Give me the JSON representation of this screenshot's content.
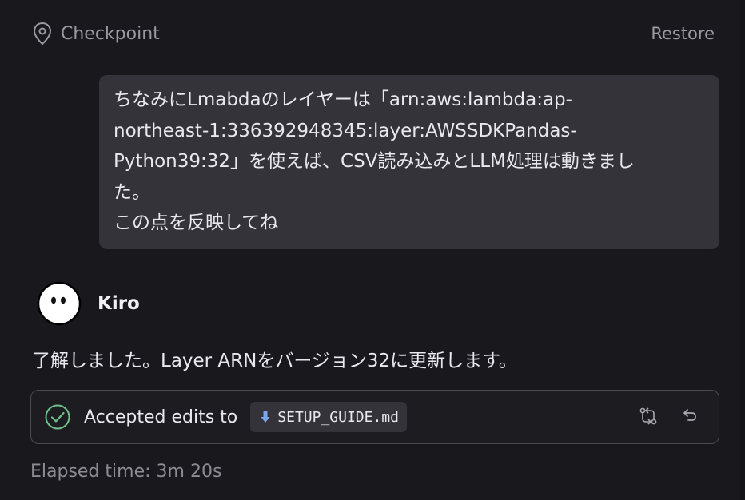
{
  "checkpoint": {
    "label": "Checkpoint",
    "restore_label": "Restore",
    "icon": "map-pin-icon"
  },
  "user_message": {
    "lines": [
      "ちなみにLmabdaのレイヤーは「arn:aws:lambda:ap-",
      "northeast-1:336392948345:layer:AWSSDKPandas-",
      "Python39:32」を使えば、CSV読み込みとLLM処理は動きまし",
      "た。",
      "この点を反映してね"
    ]
  },
  "agent": {
    "name": "Kiro",
    "avatar_icon": "ghost-avatar-icon",
    "message": "了解しました。Layer ARNをバージョン32に更新します。"
  },
  "edit_card": {
    "label": "Accepted edits to",
    "file_name": "SETUP_GUIDE.md",
    "status_icon": "check-circle-icon",
    "file_icon": "markdown-file-icon",
    "actions": [
      "compare-icon",
      "undo-icon"
    ],
    "colors": {
      "check": "#6fbf8a",
      "file_icon": "#7aa7e6"
    }
  },
  "elapsed": {
    "text": "Elapsed time: 3m 20s"
  }
}
